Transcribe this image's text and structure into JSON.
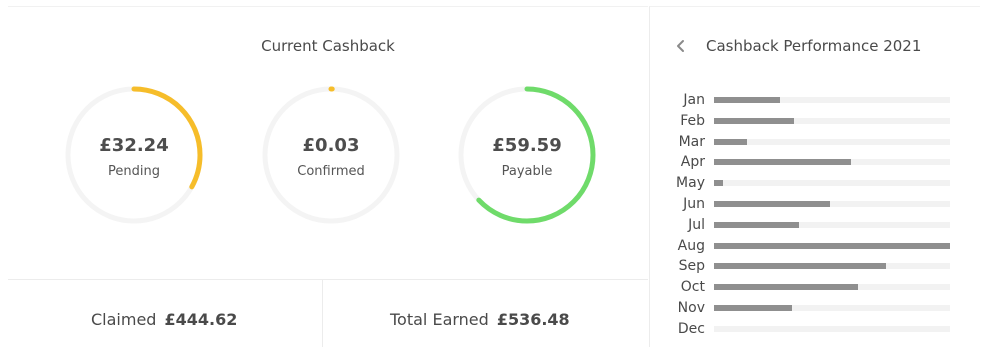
{
  "colors": {
    "pending": "#f6bd2a",
    "confirmed": "#f6bd2a",
    "payable": "#6fdb6a",
    "track": "#f4f4f4",
    "bar": "#8f8f8f"
  },
  "current_cashback": {
    "title": "Current Cashback",
    "gauges": [
      {
        "value": "£32.24",
        "label": "Pending",
        "fraction": 0.33
      },
      {
        "value": "£0.03",
        "label": "Confirmed",
        "fraction": 0.003
      },
      {
        "value": "£59.59",
        "label": "Payable",
        "fraction": 0.63
      }
    ]
  },
  "totals": {
    "claimed_label": "Claimed",
    "claimed_value": "£444.62",
    "earned_label": "Total Earned",
    "earned_value": "£536.48"
  },
  "performance": {
    "back_icon": "chevron-left-icon",
    "title": "Cashback Performance 2021",
    "max": 1.0,
    "months": [
      {
        "label": "Jan",
        "value": 0.28
      },
      {
        "label": "Feb",
        "value": 0.34
      },
      {
        "label": "Mar",
        "value": 0.14
      },
      {
        "label": "Apr",
        "value": 0.58
      },
      {
        "label": "May",
        "value": 0.04
      },
      {
        "label": "Jun",
        "value": 0.49
      },
      {
        "label": "Jul",
        "value": 0.36
      },
      {
        "label": "Aug",
        "value": 1.0
      },
      {
        "label": "Sep",
        "value": 0.73
      },
      {
        "label": "Oct",
        "value": 0.61
      },
      {
        "label": "Nov",
        "value": 0.33
      },
      {
        "label": "Dec",
        "value": 0.0
      }
    ]
  }
}
